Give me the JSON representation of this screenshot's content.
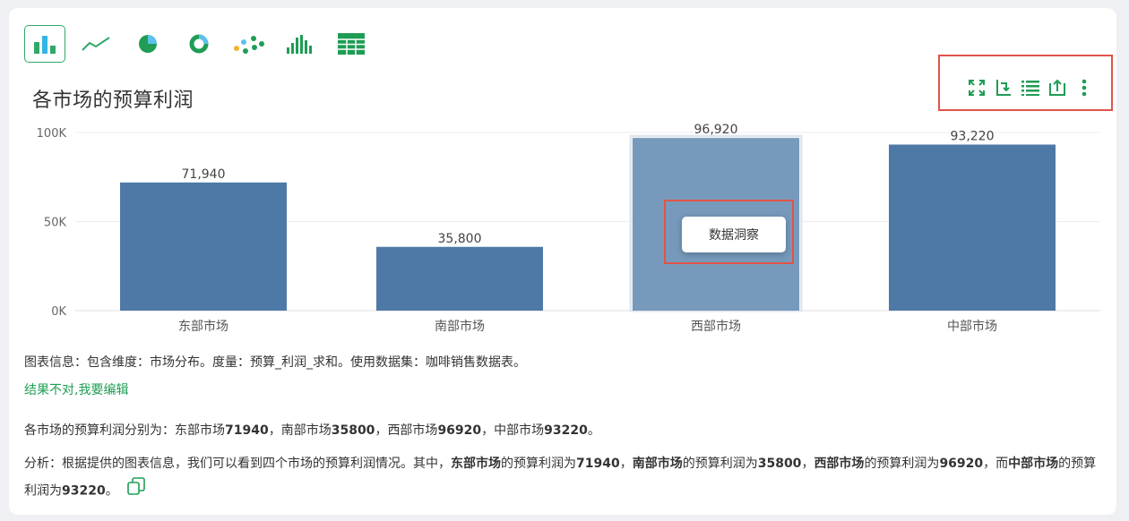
{
  "chart_types": [
    {
      "name": "bar-chart-icon",
      "active": true
    },
    {
      "name": "line-chart-icon",
      "active": false
    },
    {
      "name": "pie-chart-icon",
      "active": false
    },
    {
      "name": "donut-chart-icon",
      "active": false
    },
    {
      "name": "scatter-chart-icon",
      "active": false
    },
    {
      "name": "histogram-chart-icon",
      "active": false
    },
    {
      "name": "table-icon",
      "active": false
    }
  ],
  "toolbar_icons": [
    "fullscreen-icon",
    "swap-axes-icon",
    "list-icon",
    "export-icon",
    "more-vertical-icon"
  ],
  "popup": {
    "label": "数据洞察"
  },
  "chart_data": {
    "type": "bar",
    "title": "各市场的预算利润",
    "categories": [
      "东部市场",
      "南部市场",
      "西部市场",
      "中部市场"
    ],
    "values": [
      71940,
      35800,
      96920,
      93220
    ],
    "value_labels": [
      "71,940",
      "35,800",
      "96,920",
      "93,220"
    ],
    "yticks": [
      "0K",
      "50K",
      "100K"
    ],
    "ylim": [
      0,
      100000
    ],
    "highlighted_index": 2,
    "bar_color": "#4e79a7",
    "highlight_color": "#7799bb",
    "grid": true
  },
  "info_text": "图表信息：包含维度：市场分布。度量：预算_利润_求和。使用数据集：咖啡销售数据表。",
  "edit_link": "结果不对,我要编辑",
  "summary": {
    "prefix": "各市场的预算利润分别为：",
    "items": [
      {
        "name": "东部市场",
        "value": "71940",
        "sep": "，"
      },
      {
        "name": "南部市场",
        "value": "35800",
        "sep": "，"
      },
      {
        "name": "西部市场",
        "value": "96920",
        "sep": "，"
      },
      {
        "name": "中部市场",
        "value": "93220",
        "sep": "。"
      }
    ]
  },
  "analysis": {
    "intro": "分析：根据提供的图表信息，我们可以看到四个市场的预算利润情况。其中，",
    "m1": "东部市场",
    "t1": "的预算利润为",
    "v1": "71940",
    "s1": "，",
    "m2": "南部市场",
    "t2": "的预算利润为",
    "v2": "35800",
    "s2": "，",
    "m3": "西部市场",
    "t3": "的预算利润为",
    "v3": "96920",
    "s3": "，而",
    "m4": "中部市场",
    "t4": "的预算利润为",
    "v4": "93220",
    "s4": "。"
  },
  "colors": {
    "accent": "#1f9d55",
    "highlight_border": "#e25347"
  }
}
